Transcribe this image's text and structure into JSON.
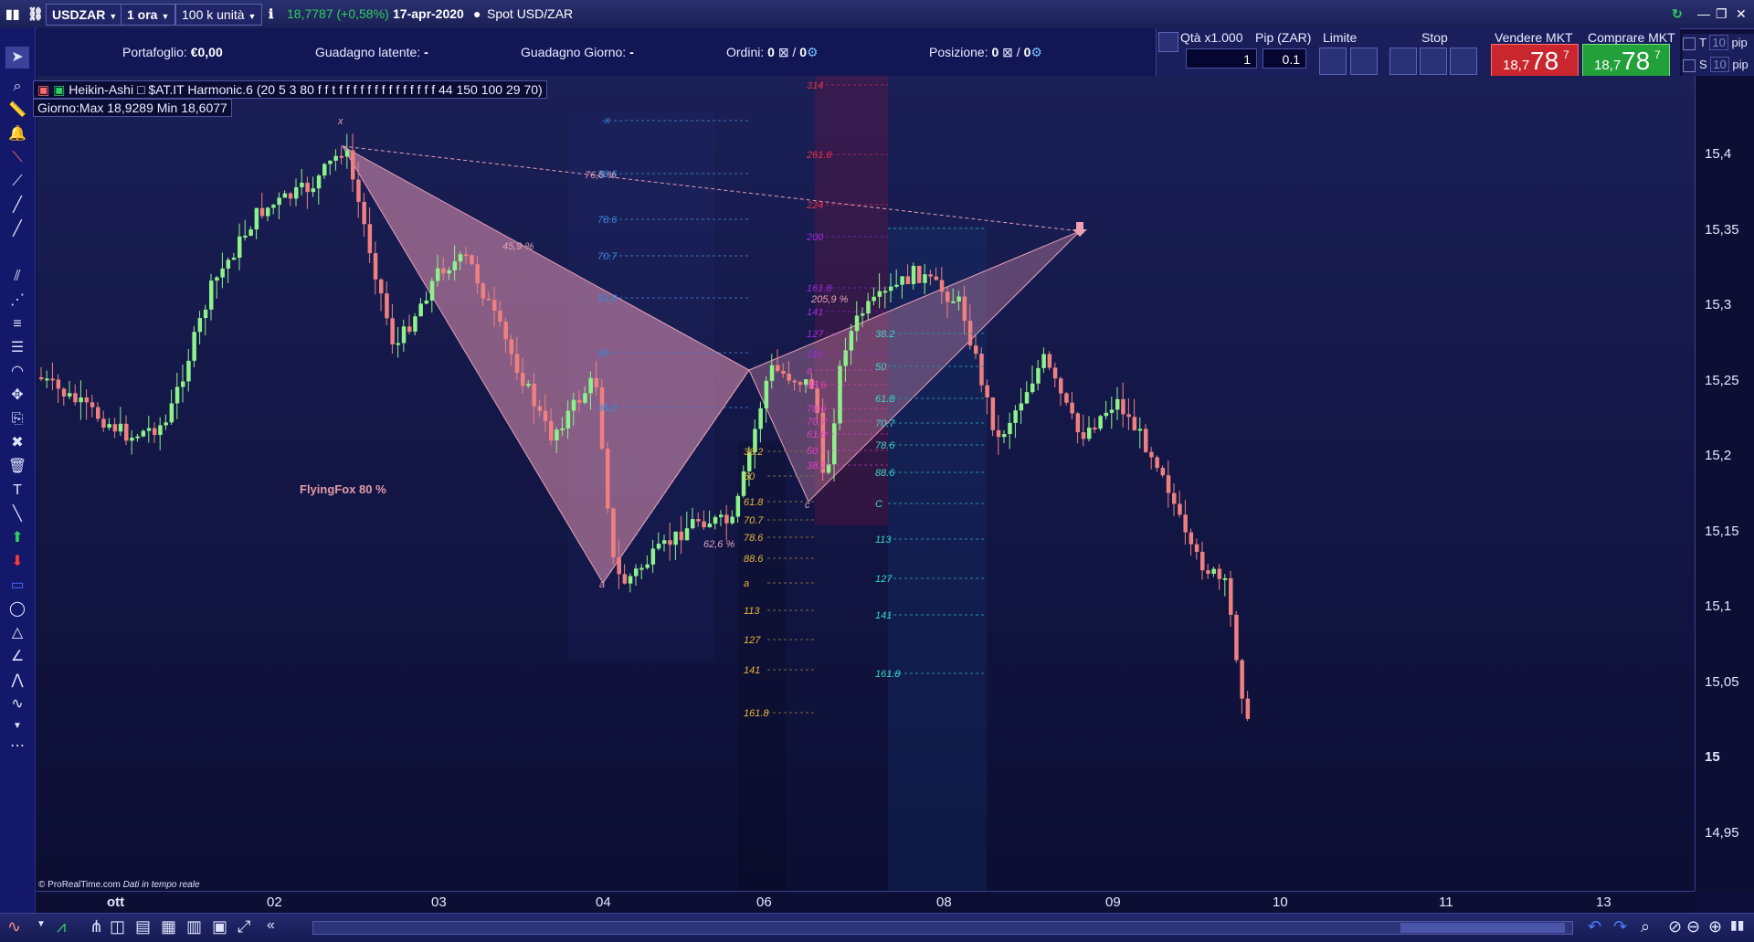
{
  "header": {
    "symbol": "USDZAR",
    "timeframe": "1 ora",
    "units": "100 k unità",
    "change": "18,7787 (+0,58%)",
    "date": "17-apr-2020",
    "spot": "Spot USD/ZAR"
  },
  "info": {
    "portfolio_label": "Portafoglio:",
    "portfolio_value": "€0,00",
    "unrealized_label": "Guadagno latente:",
    "unrealized_value": "-",
    "daily_label": "Guadagno Giorno:",
    "daily_value": "-",
    "orders_label": "Ordini:",
    "orders_value": "0",
    "orders_value2": "0",
    "position_label": "Posizione:",
    "position_value": "0",
    "position_value2": "0"
  },
  "trade": {
    "qty_label": "Qtà x1.000",
    "qty_value": "1",
    "pip_label": "Pip (ZAR)",
    "pip_value": "0.1",
    "limit_label": "Limite",
    "stop_label": "Stop",
    "sell_label": "Vendere MKT",
    "buy_label": "Comprare MKT",
    "sell_small": "18,7",
    "sell_big": "78",
    "sell_sup": "7",
    "buy_small": "18,7",
    "buy_big": "78",
    "buy_sup": "7",
    "t_label": "T",
    "t_value": "10",
    "t_unit": "pip",
    "s_label": "S",
    "s_value": "10",
    "s_unit": "pip"
  },
  "legend": {
    "chart_type": "Heikin-Ashi",
    "indicator": "$AT.IT Harmonic.6 (20 5 3 80 f f t f f f f f f f f f f f f f f 44 150 100 29 70)",
    "day_range": "Giorno:Max 18,9289 Min 18,6077"
  },
  "chart_data": {
    "type": "candlestick",
    "price_axis": [
      "15,4",
      "15,35",
      "15,3",
      "15,25",
      "15,2",
      "15,15",
      "15,1",
      "15,05",
      "15",
      "14,95"
    ],
    "date_axis": [
      "ott",
      "02",
      "03",
      "04",
      "06",
      "08",
      "09",
      "10",
      "11",
      "13"
    ],
    "pattern_name": "FlyingFox 80 %",
    "ratios": [
      "76,5 %",
      "45,9 %",
      "62,6 %",
      "205,9 %"
    ],
    "points": [
      "x",
      "a",
      "c"
    ],
    "fib_blue": [
      "88.6",
      "78.6",
      "70.7",
      "61.8",
      "50",
      "38.2"
    ],
    "fib_yellow": [
      "38.2",
      "50",
      "61.8",
      "70.7",
      "78.6",
      "88.6",
      "a",
      "113",
      "127",
      "141",
      "161.8"
    ],
    "fib_red": [
      "314",
      "261.8",
      "224",
      "200",
      "161.8",
      "141",
      "127",
      "113",
      "a",
      "88.6",
      "78.6",
      "70.7",
      "61.8",
      "50",
      "38.2"
    ],
    "fib_teal": [
      "38.2",
      "50",
      "61.8",
      "70.7",
      "78.6",
      "88.6",
      "C",
      "113",
      "127",
      "141",
      "161.8"
    ],
    "watermark": "© ProRealTime.com",
    "realtime": "Dati in tempo reale"
  }
}
